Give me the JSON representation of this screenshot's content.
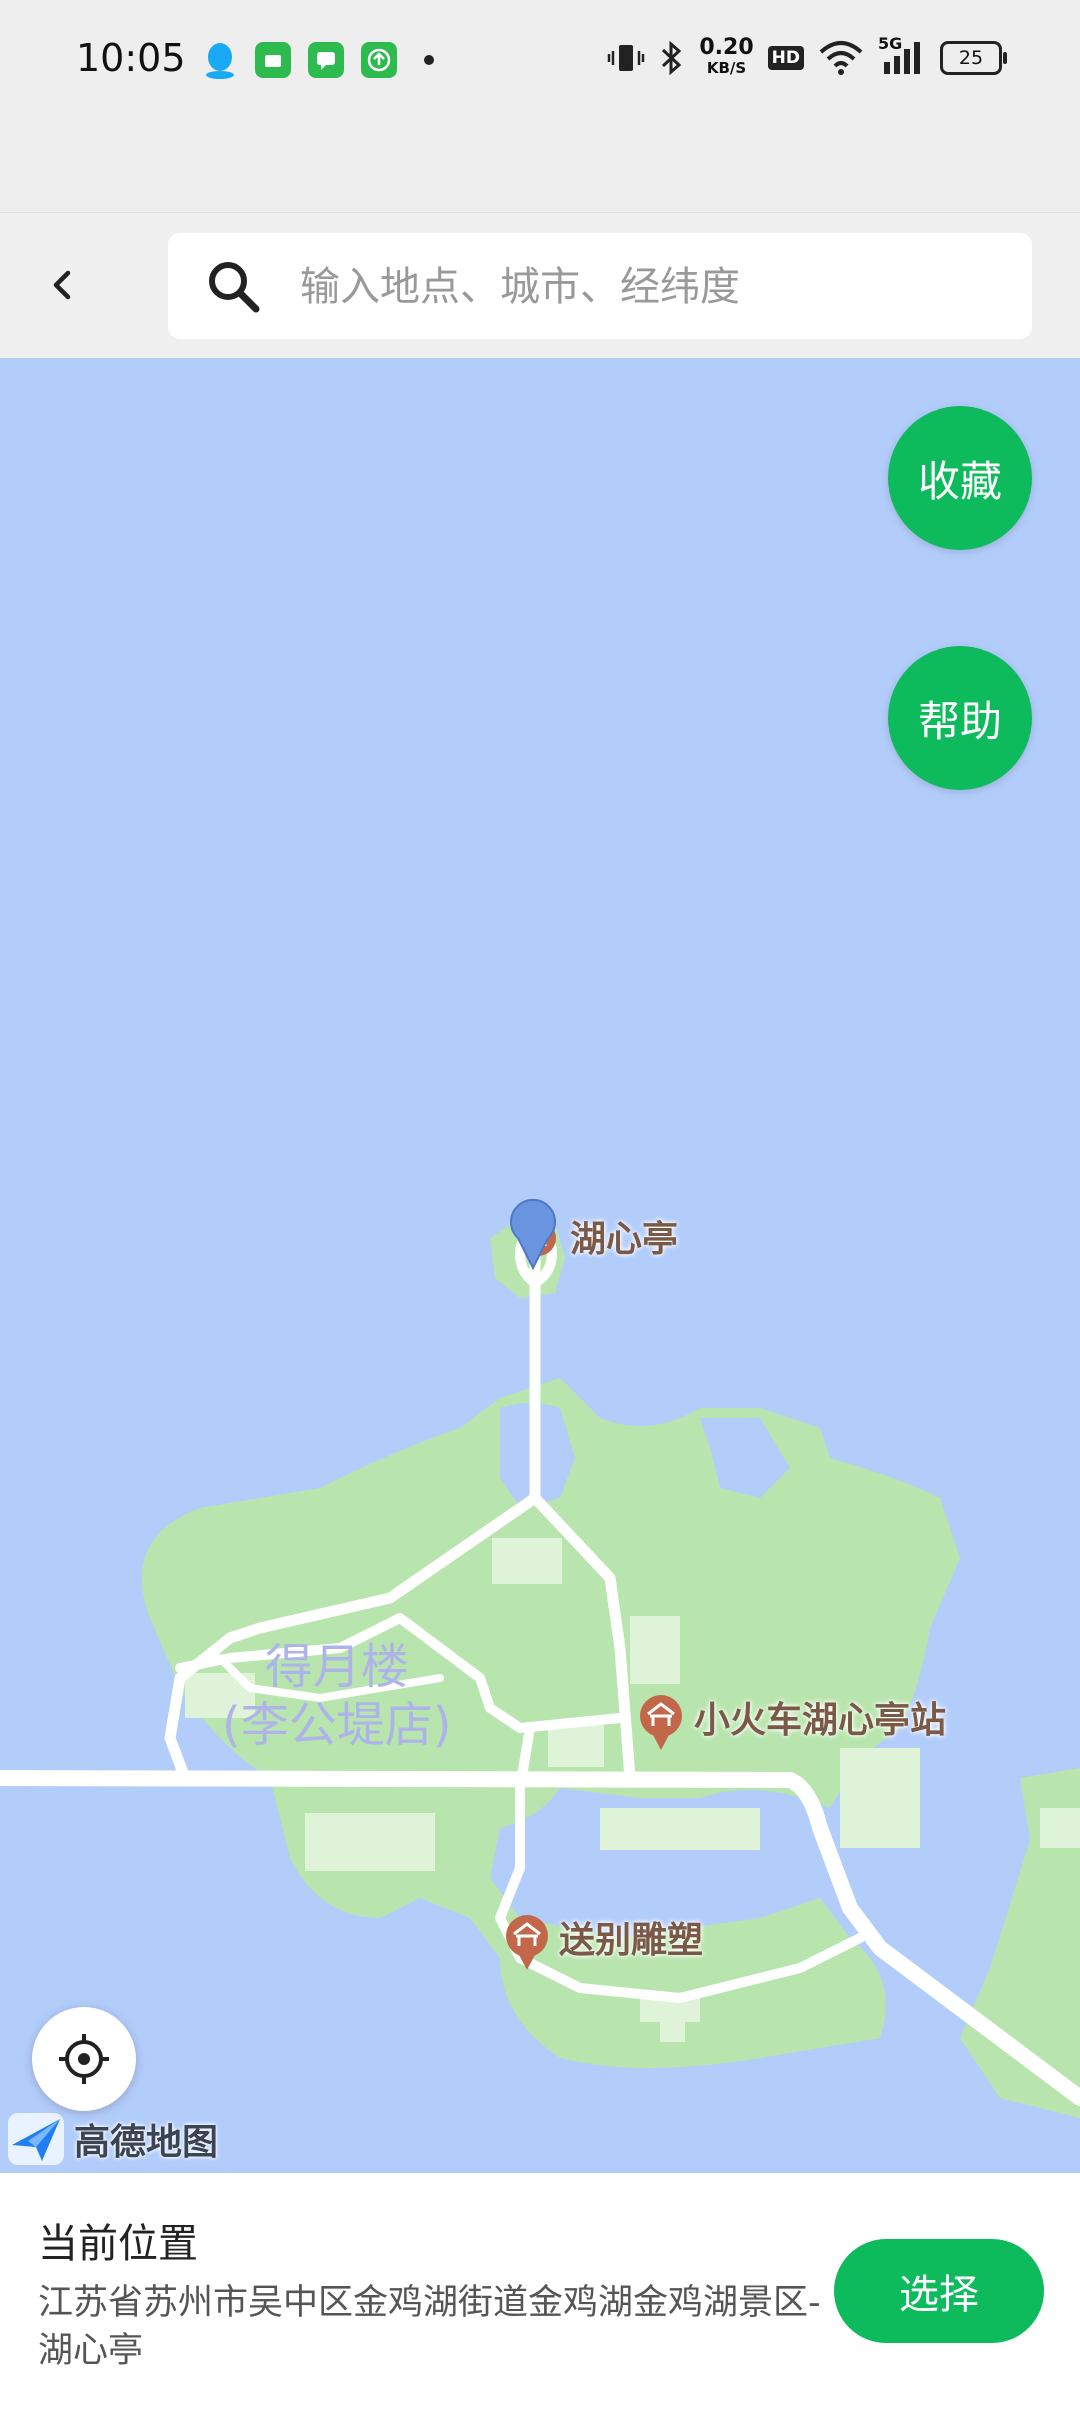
{
  "status_bar": {
    "time": "10:05",
    "network_speed_value": "0.20",
    "network_speed_unit": "KB/S",
    "hd_label": "HD",
    "signal_label": "5G",
    "battery_level": "25"
  },
  "header": {
    "search_placeholder": "输入地点、城市、经纬度"
  },
  "map": {
    "favorite_label": "收藏",
    "help_label": "帮助",
    "pois": {
      "pavilion": "湖心亭",
      "train_station": "小火车湖心亭站",
      "sculpture": "送别雕塑"
    },
    "area_label_line1": "得月楼",
    "area_label_line2": "(李公堤店)",
    "logo_text": "高德地图",
    "colors": {
      "water": "#b3cdfb",
      "land": "#b8e5ad",
      "accent": "#0dbb5c"
    }
  },
  "bottom_panel": {
    "title": "当前位置",
    "address": "江苏省苏州市吴中区金鸡湖街道金鸡湖金鸡湖景区-湖心亭",
    "select_label": "选择"
  }
}
